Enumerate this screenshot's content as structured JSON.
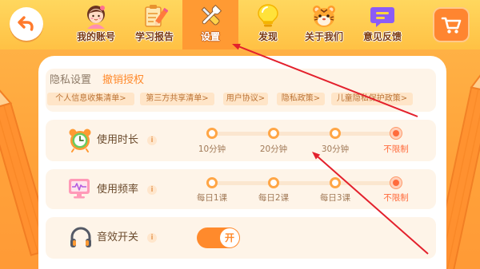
{
  "header": {
    "back_icon": "back-arrow-icon",
    "tabs": [
      {
        "label": "我的账号",
        "icon": "girl-avatar-icon",
        "selected": false
      },
      {
        "label": "学习报告",
        "icon": "study-report-icon",
        "selected": false
      },
      {
        "label": "设置",
        "icon": "tools-icon",
        "selected": true
      },
      {
        "label": "发现",
        "icon": "lightbulb-icon",
        "selected": false
      },
      {
        "label": "关于我们",
        "icon": "tiger-face-icon",
        "selected": false
      },
      {
        "label": "意见反馈",
        "icon": "feedback-bubble-icon",
        "selected": false
      }
    ],
    "cart_icon": "shopping-cart-icon"
  },
  "privacy": {
    "title": "隐私设置",
    "revoke_label": "撤销授权",
    "links": [
      "个人信息收集清单>",
      "第三方共享清单>",
      "用户协议>",
      "隐私政策>",
      "儿童隐私保护政策>"
    ]
  },
  "info_glyph": "i",
  "usage_duration": {
    "label": "使用时长",
    "icon": "alarm-clock-icon",
    "options": [
      "10分钟",
      "20分钟",
      "30分钟",
      "不限制"
    ],
    "selected_index": 3
  },
  "usage_frequency": {
    "label": "使用频率",
    "icon": "heart-monitor-icon",
    "options": [
      "每日1课",
      "每日2课",
      "每日3课",
      "不限制"
    ],
    "selected_index": 3
  },
  "sound": {
    "label": "音效开关",
    "icon": "headphones-icon",
    "toggle_label": "开",
    "on": true
  },
  "colors": {
    "accent": "#FF8A2C",
    "selected": "#FF6B3C",
    "tab_selected_bg": "#FF9A33",
    "annotation": "#E3202C"
  }
}
